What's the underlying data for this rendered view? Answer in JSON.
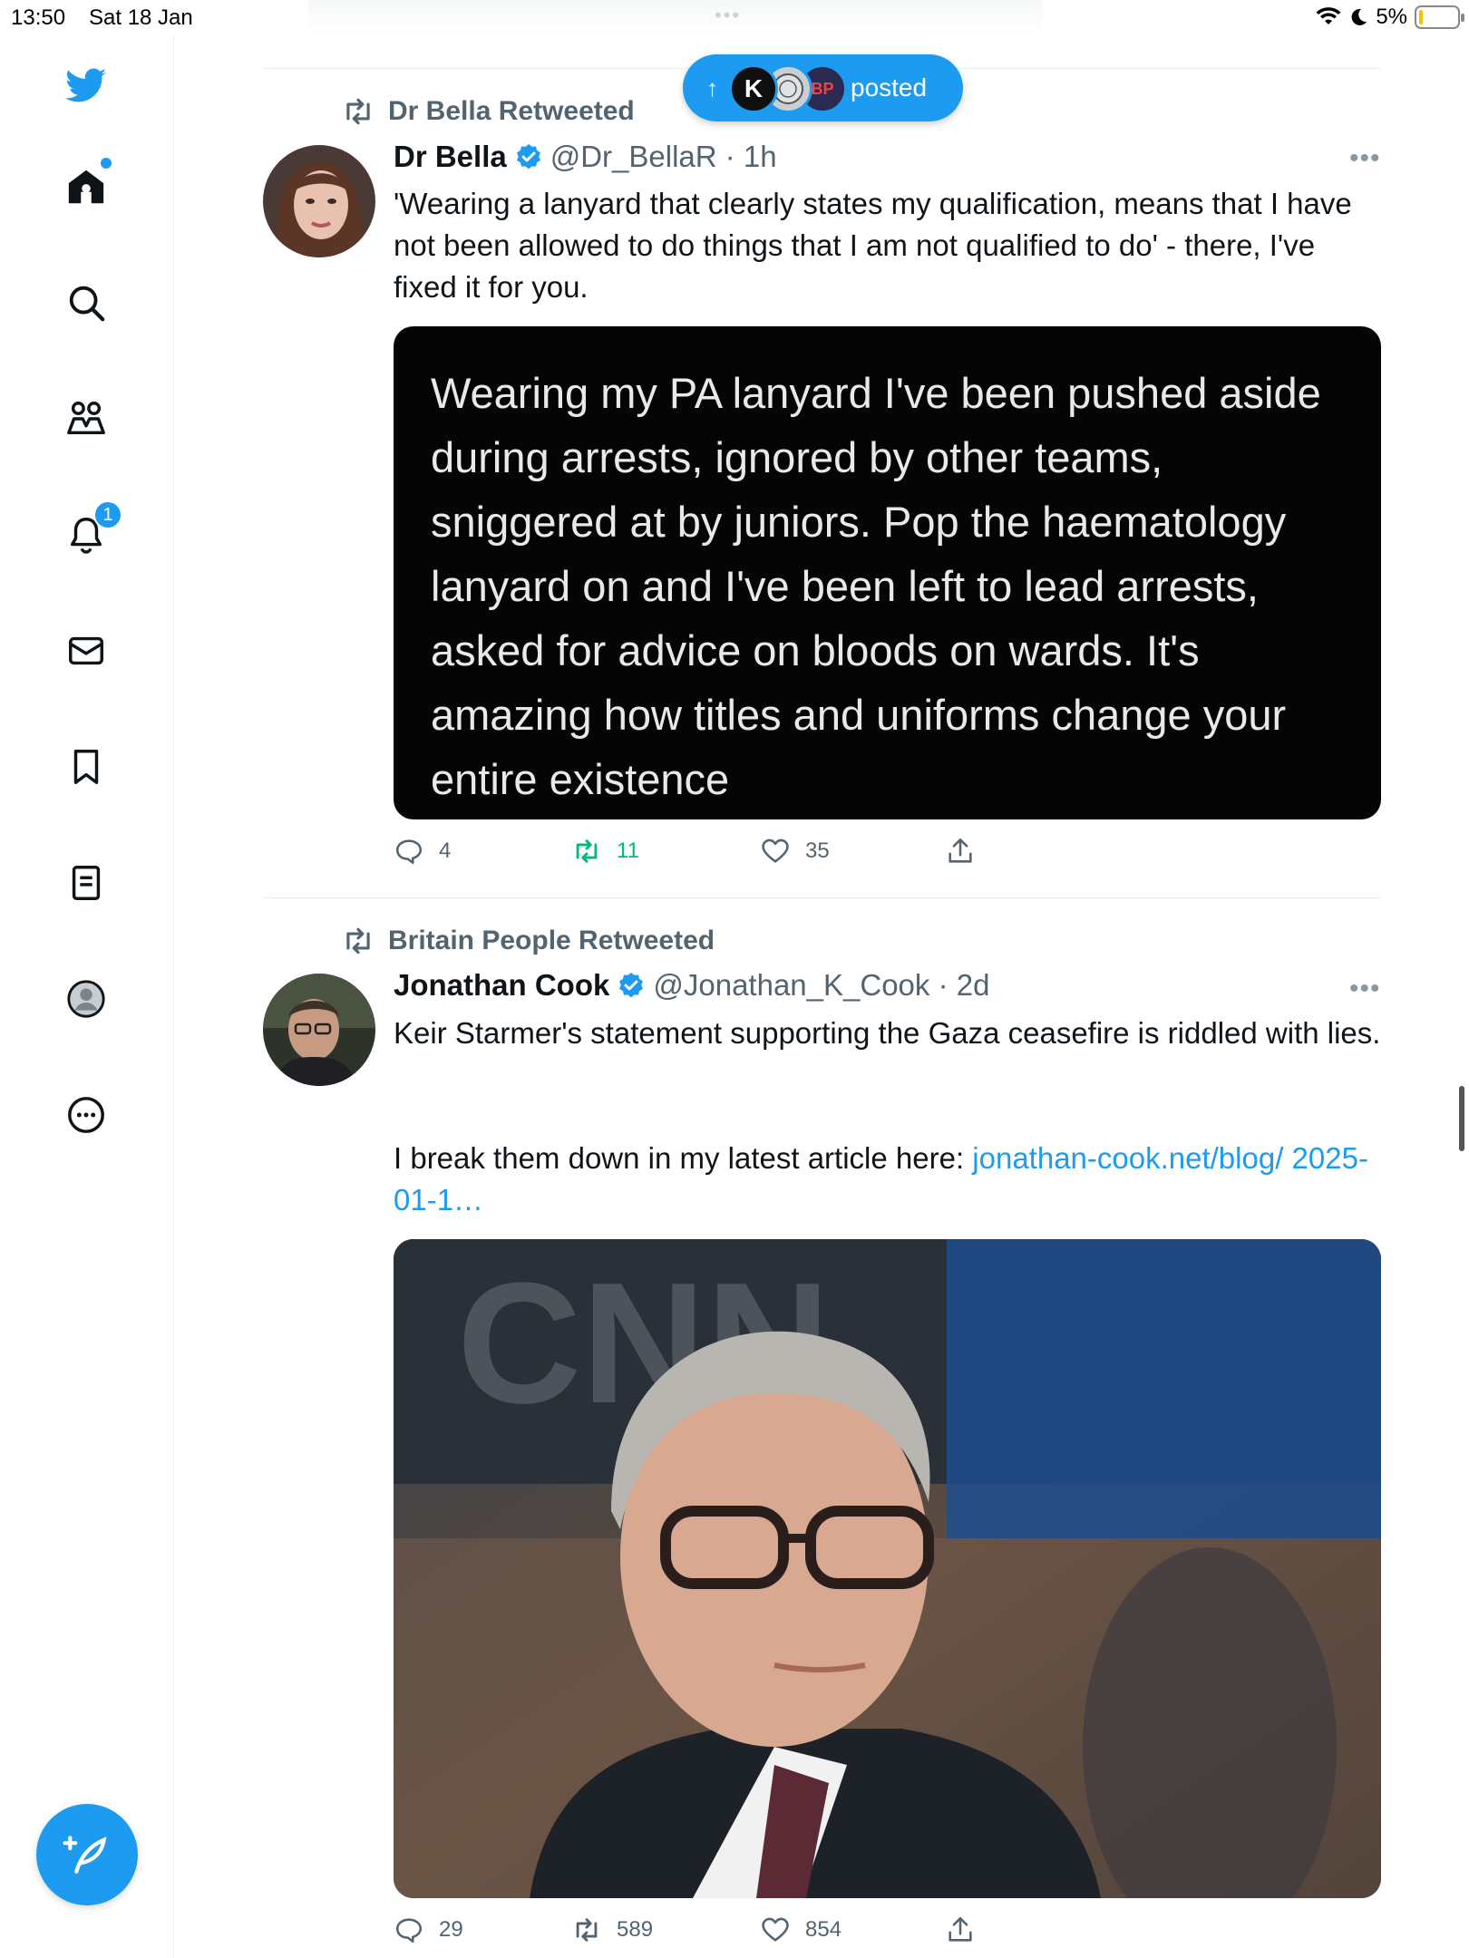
{
  "status_bar": {
    "time": "13:50",
    "date": "Sat 18 Jan",
    "battery": "5%",
    "dots": "•••"
  },
  "sidebar": {
    "items": [
      {
        "name": "home",
        "icon": "home-icon"
      },
      {
        "name": "explore",
        "icon": "search-icon"
      },
      {
        "name": "communities",
        "icon": "communities-icon"
      },
      {
        "name": "notifications",
        "icon": "bell-icon",
        "badge": "1"
      },
      {
        "name": "messages",
        "icon": "envelope-icon"
      },
      {
        "name": "bookmarks",
        "icon": "bookmark-icon"
      },
      {
        "name": "lists",
        "icon": "list-icon"
      },
      {
        "name": "profile",
        "icon": "profile-icon"
      },
      {
        "name": "more",
        "icon": "more-circle-icon"
      }
    ],
    "compose_icon": "compose-feather-icon"
  },
  "posted_pill": {
    "arrow": "↑",
    "avatar1": "K",
    "avatar3": "BP",
    "label": "posted"
  },
  "tweets": [
    {
      "retweeted_by": "Dr Bella Retweeted",
      "author": "Dr Bella",
      "handle": "@Dr_BellaR · 1h",
      "more": "•••",
      "text": "'Wearing a lanyard that clearly states my qualification, means that I have not been allowed to do things that I am not qualified to do' - there, I've fixed it for you.",
      "quote_image_text": "Wearing my PA lanyard I've been pushed aside during arrests, ignored by other teams, sniggered at by juniors. Pop the haematology lanyard on and I've been left to lead arrests, asked for advice on bloods on wards. It's amazing how titles and uniforms change your entire existence",
      "replies": "4",
      "retweets": "11",
      "likes": "35"
    },
    {
      "retweeted_by": "Britain People Retweeted",
      "author": "Jonathan Cook",
      "handle": "@Jonathan_K_Cook · 2d",
      "more": "•••",
      "text_line1": "Keir Starmer's statement supporting the Gaza ceasefire is riddled with lies.",
      "text_line2": "I break them down in my latest article here: ",
      "link": "jonathan-cook.net/blog/ 2025-01-1…",
      "replies": "29",
      "retweets": "589",
      "likes": "854"
    }
  ],
  "colors": {
    "accent": "#1d9bf0",
    "retweet_green": "#00ba7c",
    "secondary_text": "#536471"
  }
}
